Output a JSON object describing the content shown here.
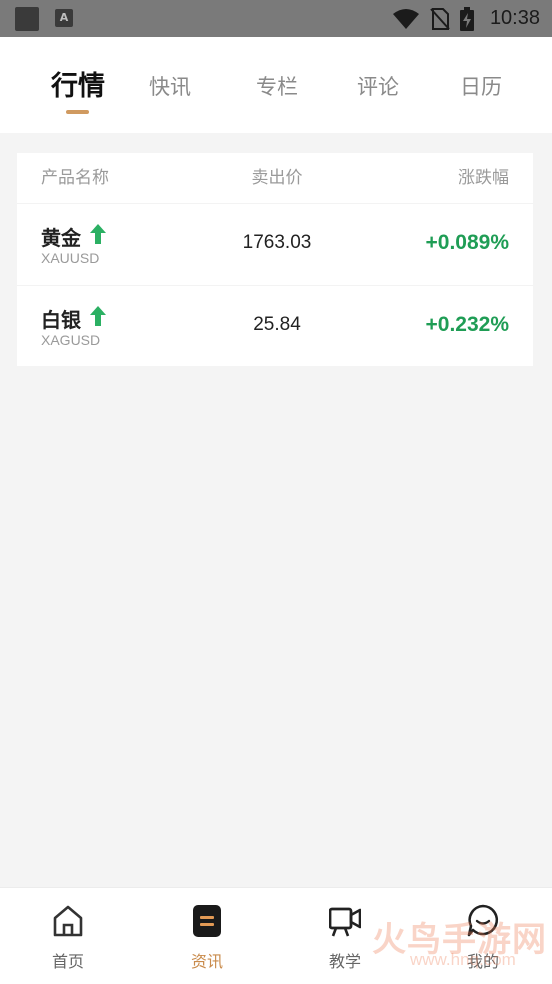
{
  "status_bar": {
    "time": "10:38",
    "app_badge": "A",
    "icons": [
      "wifi-icon",
      "no-sim-icon",
      "battery-charging-icon"
    ]
  },
  "tabs": [
    {
      "label": "行情",
      "active": true
    },
    {
      "label": "快讯",
      "active": false
    },
    {
      "label": "专栏",
      "active": false
    },
    {
      "label": "评论",
      "active": false
    },
    {
      "label": "日历",
      "active": false
    }
  ],
  "table": {
    "headers": {
      "name": "产品名称",
      "price": "卖出价",
      "change": "涨跌幅"
    },
    "rows": [
      {
        "name": "黄金",
        "code": "XAUUSD",
        "price": "1763.03",
        "change": "+0.089%",
        "trend": "up"
      },
      {
        "name": "白银",
        "code": "XAGUSD",
        "price": "25.84",
        "change": "+0.232%",
        "trend": "up"
      }
    ]
  },
  "bottom_nav": [
    {
      "label": "首页",
      "icon": "home-icon",
      "active": false
    },
    {
      "label": "资讯",
      "icon": "news-icon",
      "active": true
    },
    {
      "label": "教学",
      "icon": "video-camera-icon",
      "active": false
    },
    {
      "label": "我的",
      "icon": "chat-bubble-icon",
      "active": false
    }
  ],
  "watermark": {
    "text": "火鸟手游网",
    "sub": "www.hnq.com"
  },
  "colors": {
    "accent": "#d09a60",
    "up_green": "#1f9d55",
    "active_nav": "#c98b4c"
  }
}
